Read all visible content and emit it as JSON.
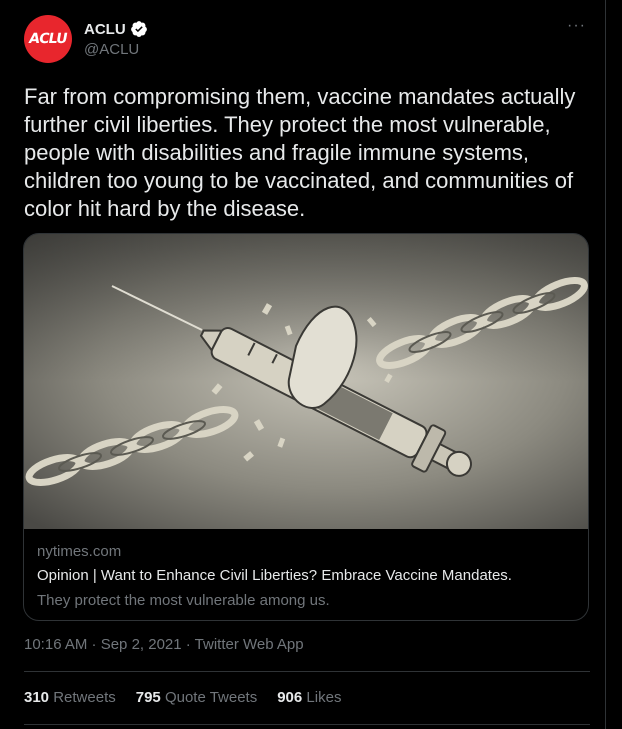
{
  "author": {
    "avatar_text": "ACLU",
    "display_name": "ACLU",
    "handle": "@ACLU",
    "verified": true
  },
  "tweet_text": "Far from compromising them, vaccine mandates actually further civil liberties. They protect the most vulnerable, people with disabilities and fragile immune systems, children too young to be vaccinated, and communities of color hit hard by the disease.",
  "card": {
    "domain": "nytimes.com",
    "title": "Opinion | Want to Enhance Civil Liberties? Embrace Vaccine Mandates.",
    "description": "They protect the most vulnerable among us."
  },
  "timestamp": "10:16 AM · Sep 2, 2021 · Twitter Web App",
  "stats": {
    "retweets_count": "310",
    "retweets_label": "Retweets",
    "quotes_count": "795",
    "quotes_label": "Quote Tweets",
    "likes_count": "906",
    "likes_label": "Likes"
  },
  "colors": {
    "background": "#000000",
    "text": "#e7e9ea",
    "secondary": "#71767b",
    "border": "#2f3336",
    "brand_red": "#e8262d",
    "verified_badge": "#ffffff"
  },
  "icons": [
    "verified-icon",
    "more-icon"
  ]
}
